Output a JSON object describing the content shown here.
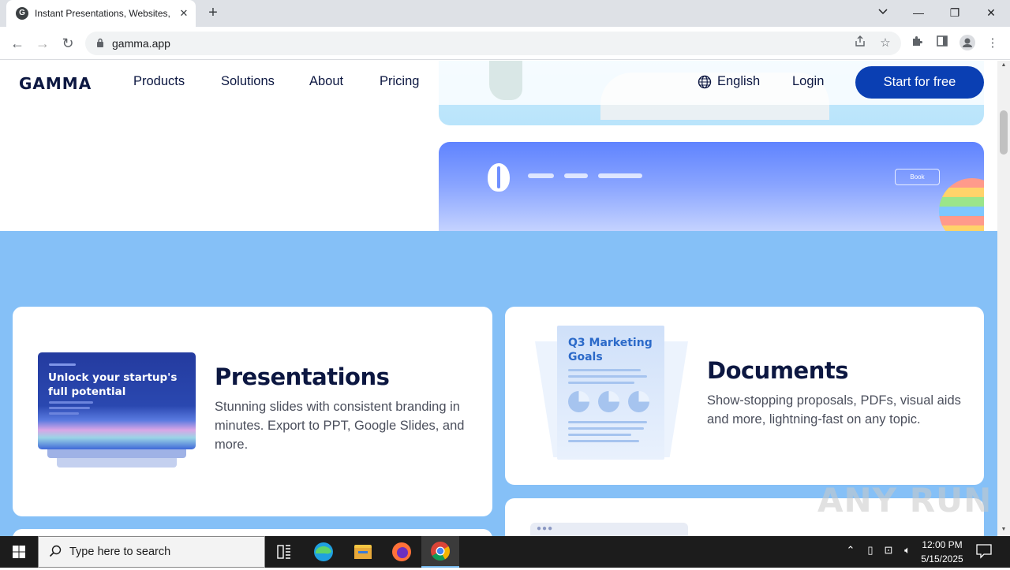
{
  "browser": {
    "tab_title": "Instant Presentations, Websites,",
    "favicon_letter": "G",
    "close_glyph": "✕",
    "new_tab_glyph": "+",
    "url": "gamma.app",
    "window_controls": {
      "minimize": "—",
      "restore": "❐",
      "close": "✕"
    },
    "nav": {
      "back": "←",
      "forward": "→",
      "reload": "↻"
    },
    "toolbar_icons": [
      "share-icon",
      "bookmark-star-icon",
      "extensions-icon",
      "side-panel-icon",
      "profile-icon",
      "menu-icon"
    ]
  },
  "site": {
    "logo": "GAMMA",
    "nav_items": [
      "Products",
      "Solutions",
      "About",
      "Pricing"
    ],
    "language": "English",
    "login": "Login",
    "cta": "Start for free",
    "hero_preview": {
      "book_label": "Book"
    }
  },
  "features": {
    "presentations": {
      "title": "Presentations",
      "description": "Stunning slides with consistent branding in minutes. Export to PPT, Google Slides, and more.",
      "thumbnail_text": "Unlock your startup's full potential"
    },
    "documents": {
      "title": "Documents",
      "description": "Show-stopping proposals, PDFs, visual aids and more, lightning-fast on any topic.",
      "thumbnail_text": "Q3 Marketing Goals"
    }
  },
  "watermark": "ANY RUN",
  "taskbar": {
    "search_placeholder": "Type here to search",
    "time": "12:00 PM",
    "date": "5/15/2025"
  },
  "colors": {
    "brand_dark": "#0c1741",
    "cta_blue": "#0a3fb3",
    "band_blue": "#85c0f7"
  }
}
